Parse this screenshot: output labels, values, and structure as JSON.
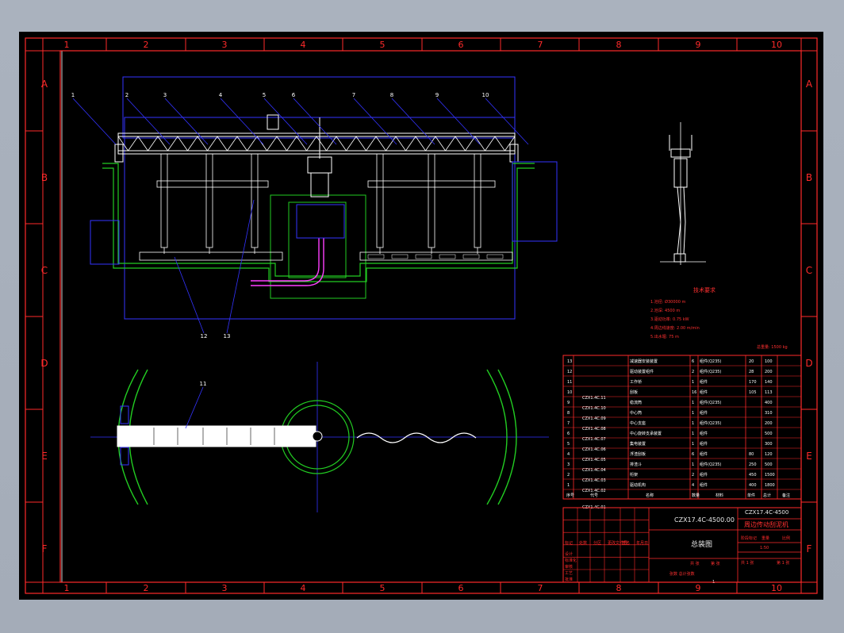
{
  "frame": {
    "columns": [
      "1",
      "2",
      "3",
      "4",
      "5",
      "6",
      "7",
      "8",
      "9",
      "10"
    ],
    "rows": [
      "A",
      "B",
      "C",
      "D",
      "E",
      "F"
    ]
  },
  "colors": {
    "background": "#000000",
    "frame": "#ff2a2a",
    "outline": "#ffffff",
    "structure": "#3333ff",
    "concrete": "#22cc22",
    "title_block": "#ff2a2a"
  },
  "drawing": {
    "callouts_top": [
      "1",
      "2",
      "3",
      "4",
      "5",
      "6",
      "7",
      "8",
      "9",
      "10"
    ],
    "callouts_bottom": [
      "12",
      "13"
    ],
    "plan_callout": "11",
    "tech_title": "技术要求",
    "tech_lines": [
      "1.池径:          Ø30000 m",
      "2.池深:          4500 m",
      "3.驱动功率:      0.75 kW",
      "4.周边线速度:    2.00 m/min",
      "5.出水堰:        75 m"
    ],
    "scale_note": "总重量: 1500 kg"
  },
  "parts_table": {
    "rows": [
      {
        "no": "13",
        "code": "",
        "name": "减速器安装装置",
        "qty": "6",
        "mat": "组件(Q235)",
        "w1": "20",
        "w2": "100"
      },
      {
        "no": "12",
        "code": "",
        "name": "驱动装置组件",
        "qty": "2",
        "mat": "组件(Q235)",
        "w1": "28",
        "w2": "200"
      },
      {
        "no": "11",
        "code": "",
        "name": "工作桥",
        "qty": "1",
        "mat": "组件",
        "w1": "170",
        "w2": "140"
      },
      {
        "no": "10",
        "code": "CZX1.4C.11",
        "name": "刮板",
        "qty": "16",
        "mat": "组件",
        "w1": "105",
        "w2": "113"
      },
      {
        "no": "9",
        "code": "CZX1.4C.10",
        "name": "稳流筒",
        "qty": "1",
        "mat": "组件(Q235)",
        "w1": "",
        "w2": "400"
      },
      {
        "no": "8",
        "code": "CZX1.4C.09",
        "name": "中心筒",
        "qty": "1",
        "mat": "组件",
        "w1": "",
        "w2": "310"
      },
      {
        "no": "7",
        "code": "CZX1.4C.08",
        "name": "中心支座",
        "qty": "1",
        "mat": "组件(Q235)",
        "w1": "",
        "w2": "200"
      },
      {
        "no": "6",
        "code": "CZX1.4C.07",
        "name": "中心旋转支承装置",
        "qty": "1",
        "mat": "组件",
        "w1": "",
        "w2": "500"
      },
      {
        "no": "5",
        "code": "CZX1.4C.06",
        "name": "集电装置",
        "qty": "1",
        "mat": "组件",
        "w1": "",
        "w2": "300"
      },
      {
        "no": "4",
        "code": "CZX1.4C.05",
        "name": "浮渣刮板",
        "qty": "6",
        "mat": "组件",
        "w1": "80",
        "w2": "120"
      },
      {
        "no": "3",
        "code": "CZX1.4C.04",
        "name": "排渣斗",
        "qty": "1",
        "mat": "组件(Q235)",
        "w1": "250",
        "w2": "500"
      },
      {
        "no": "2",
        "code": "CZX1.4C.03",
        "name": "桁架",
        "qty": "2",
        "mat": "组件",
        "w1": "450",
        "w2": "1500"
      },
      {
        "no": "1",
        "code": "CZX1.4C.02",
        "name": "驱动机构",
        "qty": "4",
        "mat": "组件",
        "w1": "400",
        "w2": "1800"
      }
    ],
    "extra_codes": [
      "CZX1.4C.01"
    ],
    "header": [
      "序号",
      "代号",
      "名称",
      "数量",
      "材料",
      "单件",
      "总计",
      "备注"
    ]
  },
  "title_block": {
    "drawing_no": "CZX17.4C-4500.00",
    "drawing_no_right": "CZX17.4C-4500",
    "name": "周边传动刮泥机",
    "sheet_title": "总装图",
    "rows_left": [
      "标记",
      "处数",
      "分区",
      "更改文件号",
      "签名",
      "年月日"
    ],
    "rows_left2": [
      "设计",
      "标准化",
      "审核",
      "工艺",
      "批准"
    ],
    "stage_labels": [
      "阶段标记",
      "重量",
      "比例"
    ],
    "scale": "1:50",
    "sheet": "共 1 张",
    "sheet_no": "第 1 张",
    "footer_mid": [
      "共 张",
      "第 张"
    ],
    "footer_small": "张数  总计张数",
    "page_num": "1"
  }
}
